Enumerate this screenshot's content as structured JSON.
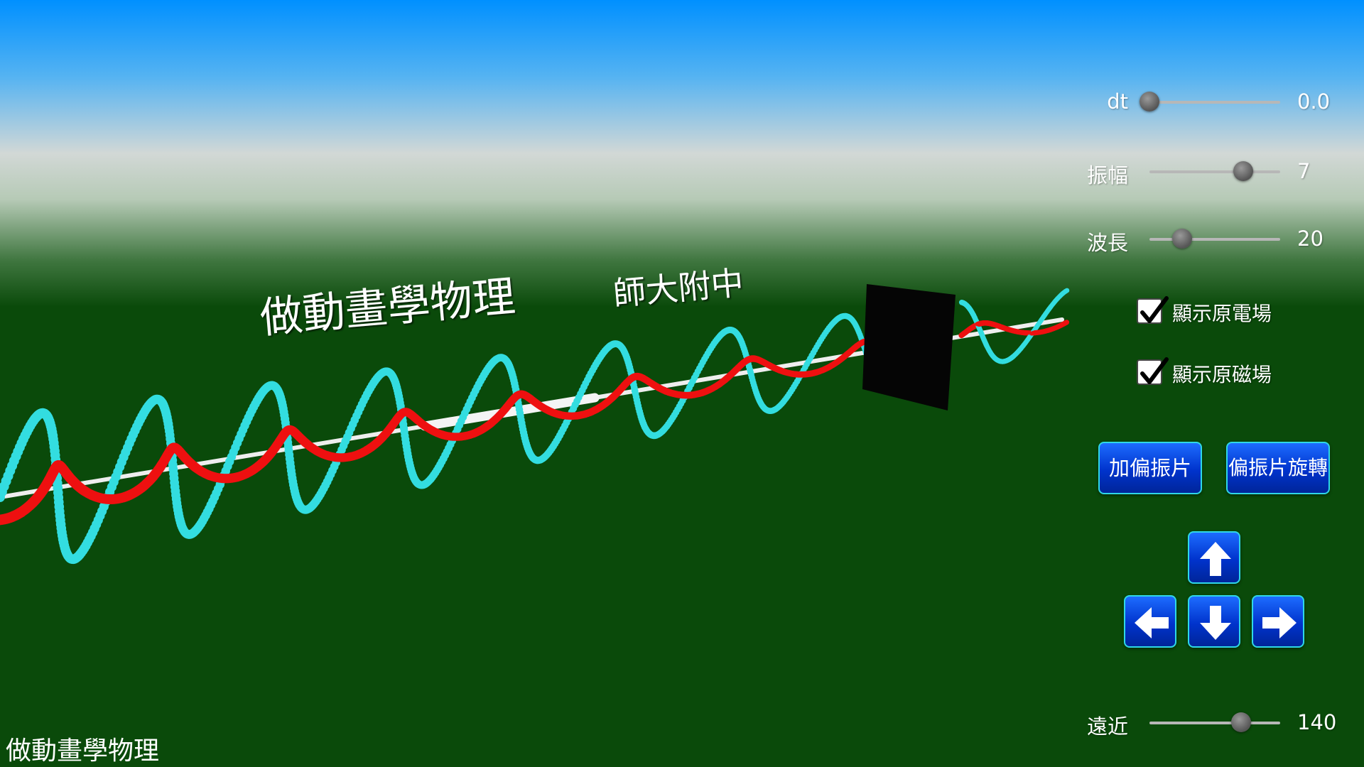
{
  "app": {
    "title_3d": "做動畫學物理",
    "school_3d": "師大附中",
    "footer": "做動畫學物理"
  },
  "controls": {
    "dt": {
      "label": "dt",
      "value": "0.0",
      "fraction": 0.0
    },
    "amplitude": {
      "label": "振幅",
      "value": "7",
      "fraction": 0.72
    },
    "wavelength": {
      "label": "波長",
      "value": "20",
      "fraction": 0.25
    },
    "distance": {
      "label": "遠近",
      "value": "140",
      "fraction": 0.7
    }
  },
  "checkboxes": {
    "show_e_field": {
      "label": "顯示原電場",
      "checked": true
    },
    "show_b_field": {
      "label": "顯示原磁場",
      "checked": true
    }
  },
  "buttons": {
    "add_polarizer": "加偏振片",
    "rotate_polarizer": "偏振片旋轉"
  },
  "icons": {
    "up": "arrow-up-icon",
    "down": "arrow-down-icon",
    "left": "arrow-left-icon",
    "right": "arrow-right-icon"
  },
  "colors": {
    "ground": "#0a4a0a",
    "sky_top": "#0090ff",
    "e_field": "#ee1010",
    "b_field": "#33dde0",
    "button": "#0040dd",
    "button_border": "#2fd7e6"
  }
}
